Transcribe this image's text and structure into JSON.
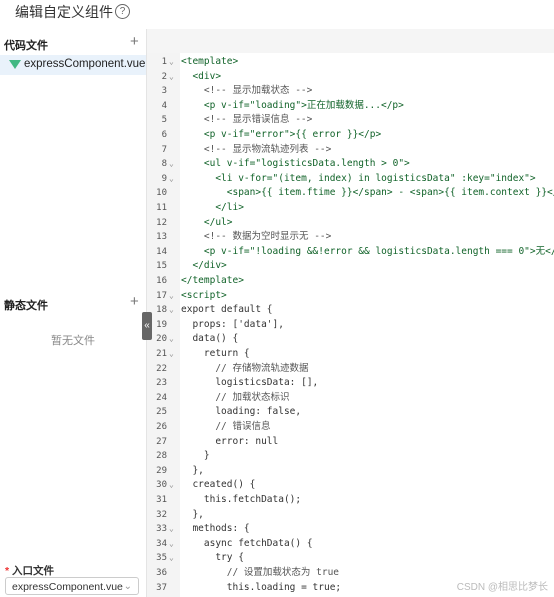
{
  "header": {
    "title": "编辑自定义组件",
    "help_icon": "?"
  },
  "sidebar": {
    "code_files_title": "代码文件",
    "add_symbol": "+",
    "files": [
      "expressComponent.vue"
    ],
    "static_files_title": "静态文件",
    "no_files_text": "暂无文件",
    "collapse_symbol": "«",
    "entry_label": "入口文件",
    "entry_required_mark": "*",
    "entry_value": "expressComponent.vue"
  },
  "editor": {
    "lines": [
      {
        "n": "1",
        "f": "⌄",
        "t": "<template>"
      },
      {
        "n": "2",
        "f": "⌄",
        "t": "  <div>"
      },
      {
        "n": "3",
        "f": "",
        "t": "    <!-- 显示加载状态 -->"
      },
      {
        "n": "4",
        "f": "",
        "t": "    <p v-if=\"loading\">正在加载数据...</p>"
      },
      {
        "n": "5",
        "f": "",
        "t": "    <!-- 显示错误信息 -->"
      },
      {
        "n": "6",
        "f": "",
        "t": "    <p v-if=\"error\">{{ error }}</p>"
      },
      {
        "n": "7",
        "f": "",
        "t": "    <!-- 显示物流轨迹列表 -->"
      },
      {
        "n": "8",
        "f": "⌄",
        "t": "    <ul v-if=\"logisticsData.length > 0\">"
      },
      {
        "n": "9",
        "f": "⌄",
        "t": "      <li v-for=\"(item, index) in logisticsData\" :key=\"index\">"
      },
      {
        "n": "10",
        "f": "",
        "t": "        <span>{{ item.ftime }}</span> - <span>{{ item.context }}</span>"
      },
      {
        "n": "11",
        "f": "",
        "t": "      </li>"
      },
      {
        "n": "12",
        "f": "",
        "t": "    </ul>"
      },
      {
        "n": "13",
        "f": "",
        "t": "    <!-- 数据为空时显示无 -->"
      },
      {
        "n": "14",
        "f": "",
        "t": "    <p v-if=\"!loading &&!error && logisticsData.length === 0\">无</p>"
      },
      {
        "n": "15",
        "f": "",
        "t": "  </div>"
      },
      {
        "n": "16",
        "f": "",
        "t": "</template>"
      },
      {
        "n": "17",
        "f": "⌄",
        "t": "<script>"
      },
      {
        "n": "18",
        "f": "⌄",
        "t": "export default {"
      },
      {
        "n": "19",
        "f": "",
        "t": "  props: ['data'],"
      },
      {
        "n": "20",
        "f": "⌄",
        "t": "  data() {"
      },
      {
        "n": "21",
        "f": "⌄",
        "t": "    return {"
      },
      {
        "n": "22",
        "f": "",
        "t": "      // 存储物流轨迹数据"
      },
      {
        "n": "23",
        "f": "",
        "t": "      logisticsData: [],"
      },
      {
        "n": "24",
        "f": "",
        "t": "      // 加载状态标识"
      },
      {
        "n": "25",
        "f": "",
        "t": "      loading: false,"
      },
      {
        "n": "26",
        "f": "",
        "t": "      // 错误信息"
      },
      {
        "n": "27",
        "f": "",
        "t": "      error: null"
      },
      {
        "n": "28",
        "f": "",
        "t": "    }"
      },
      {
        "n": "29",
        "f": "",
        "t": "  },"
      },
      {
        "n": "30",
        "f": "⌄",
        "t": "  created() {"
      },
      {
        "n": "31",
        "f": "",
        "t": "    this.fetchData();"
      },
      {
        "n": "32",
        "f": "",
        "t": "  },"
      },
      {
        "n": "33",
        "f": "⌄",
        "t": "  methods: {"
      },
      {
        "n": "34",
        "f": "⌄",
        "t": "    async fetchData() {"
      },
      {
        "n": "35",
        "f": "⌄",
        "t": "      try {"
      },
      {
        "n": "36",
        "f": "",
        "t": "        // 设置加载状态为 true"
      },
      {
        "n": "37",
        "f": "",
        "t": "        this.loading = true;"
      }
    ]
  },
  "watermark": "CSDN @相思比梦长"
}
